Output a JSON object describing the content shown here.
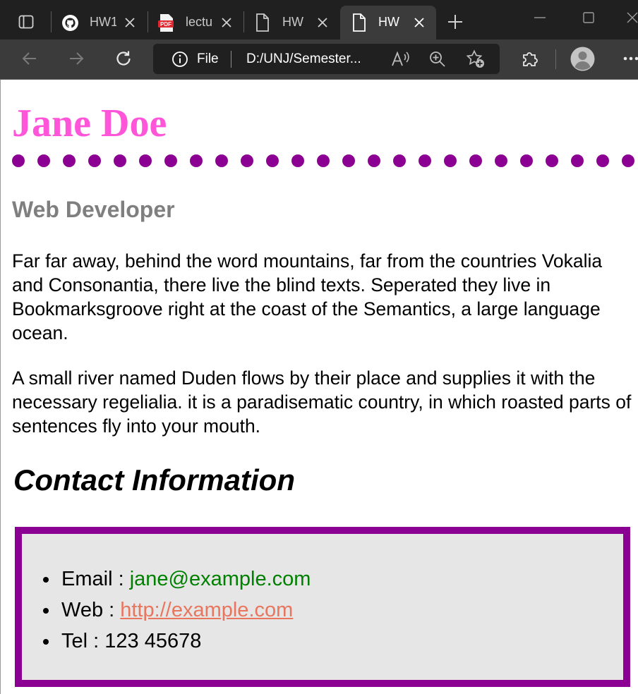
{
  "browser": {
    "tabs": [
      {
        "title": "HW1",
        "icon": "github-icon"
      },
      {
        "title": "lectu",
        "icon": "pdf-icon"
      },
      {
        "title": "HW",
        "icon": "page-icon"
      },
      {
        "title": "HW",
        "icon": "page-icon",
        "active": true
      }
    ],
    "address": {
      "scheme_label": "File",
      "url": "D:/UNJ/Semester..."
    }
  },
  "page": {
    "name": "Jane Doe",
    "role": "Web Developer",
    "paragraphs": [
      "Far far away, behind the word mountains, far from the countries Vokalia and Consonantia, there live the blind texts. Seperated they live in Bookmarksgroove right at the coast of the Semantics, a large language ocean.",
      "A small river named Duden flows by their place and supplies it with the necessary regelialia. it is a paradisematic country, in which roasted parts of sentences fly into your mouth."
    ],
    "contact_heading": "Contact Information",
    "contacts": [
      {
        "label": "Email : ",
        "value": "jane@example.com"
      },
      {
        "label": "Web : ",
        "value": "http://example.com"
      },
      {
        "label": "Tel : ",
        "value": "123 45678"
      }
    ]
  },
  "colors": {
    "name": "#ff55d9",
    "divider_dots": "#8b0093",
    "role": "#7f7f7f",
    "box_border": "#8b0093",
    "box_background": "#e6e6e6",
    "email": "#008000",
    "link": "#e8765e"
  }
}
